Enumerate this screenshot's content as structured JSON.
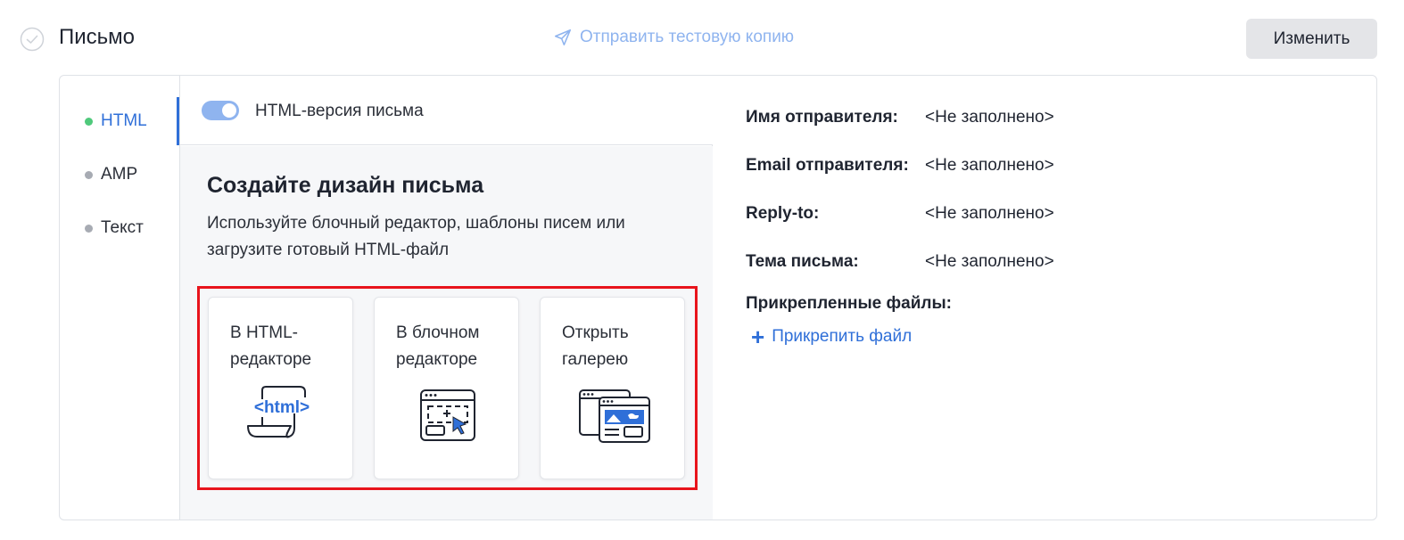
{
  "header": {
    "title": "Письмо",
    "send_test_label": "Отправить тестовую копию",
    "edit_label": "Изменить"
  },
  "versions": {
    "items": [
      {
        "label": "HTML",
        "active": true
      },
      {
        "label": "AMP",
        "active": false
      },
      {
        "label": "Текст",
        "active": false
      }
    ]
  },
  "html_version": {
    "toggle_label": "HTML-версия письма",
    "enabled": true
  },
  "design": {
    "title": "Создайте дизайн письма",
    "description": "Используйте блочный редактор, шаблоны писем или загрузите готовый HTML-файл",
    "options": [
      {
        "label": "В HTML-редакторе",
        "icon": "html-code-icon"
      },
      {
        "label": "В блочном редакторе",
        "icon": "block-editor-icon"
      },
      {
        "label": "Открыть галерею",
        "icon": "gallery-icon"
      }
    ]
  },
  "sender": {
    "fields": [
      {
        "label": "Имя отправителя:",
        "value": "<Не заполнено>"
      },
      {
        "label": "Email отправителя:",
        "value": "<Не заполнено>"
      },
      {
        "label": "Reply-to:",
        "value": "<Не заполнено>"
      },
      {
        "label": "Тема письма:",
        "value": "<Не заполнено>"
      }
    ],
    "attachments_label": "Прикрепленные файлы:",
    "attach_link": "Прикрепить файл"
  },
  "colors": {
    "accent": "#2f6fd8",
    "accent_light": "#8fb4ef",
    "active_dot": "#4fc97b",
    "highlight_border": "#e8141c"
  }
}
